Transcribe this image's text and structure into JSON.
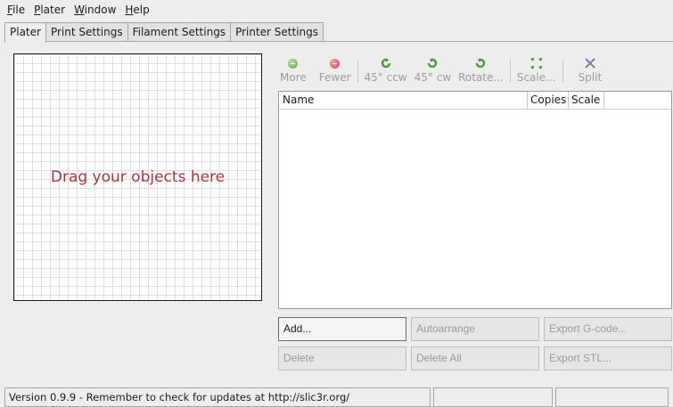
{
  "menubar": [
    {
      "accel": "F",
      "rest": "ile"
    },
    {
      "accel": "P",
      "rest": "later"
    },
    {
      "accel": "W",
      "rest": "indow"
    },
    {
      "accel": "H",
      "rest": "elp"
    }
  ],
  "tabs": [
    "Plater",
    "Print Settings",
    "Filament Settings",
    "Printer Settings"
  ],
  "bed": {
    "hint": "Drag your objects here"
  },
  "toolbar": {
    "more": "More",
    "fewer": "Fewer",
    "rotate_ccw": "45° ccw",
    "rotate_cw": "45° cw",
    "rotate": "Rotate...",
    "scale": "Scale...",
    "split": "Split"
  },
  "object_list": {
    "columns": [
      "Name",
      "Copies",
      "Scale"
    ],
    "rows": []
  },
  "actions": {
    "add": "Add...",
    "autoarrange": "Autoarrange",
    "export_gcode": "Export G-code...",
    "delete": "Delete",
    "delete_all": "Delete All",
    "export_stl": "Export STL..."
  },
  "status": {
    "message": "Version 0.9.9 - Remember to check for updates at http://slic3r.org/",
    "cell2": "",
    "cell3": ""
  }
}
